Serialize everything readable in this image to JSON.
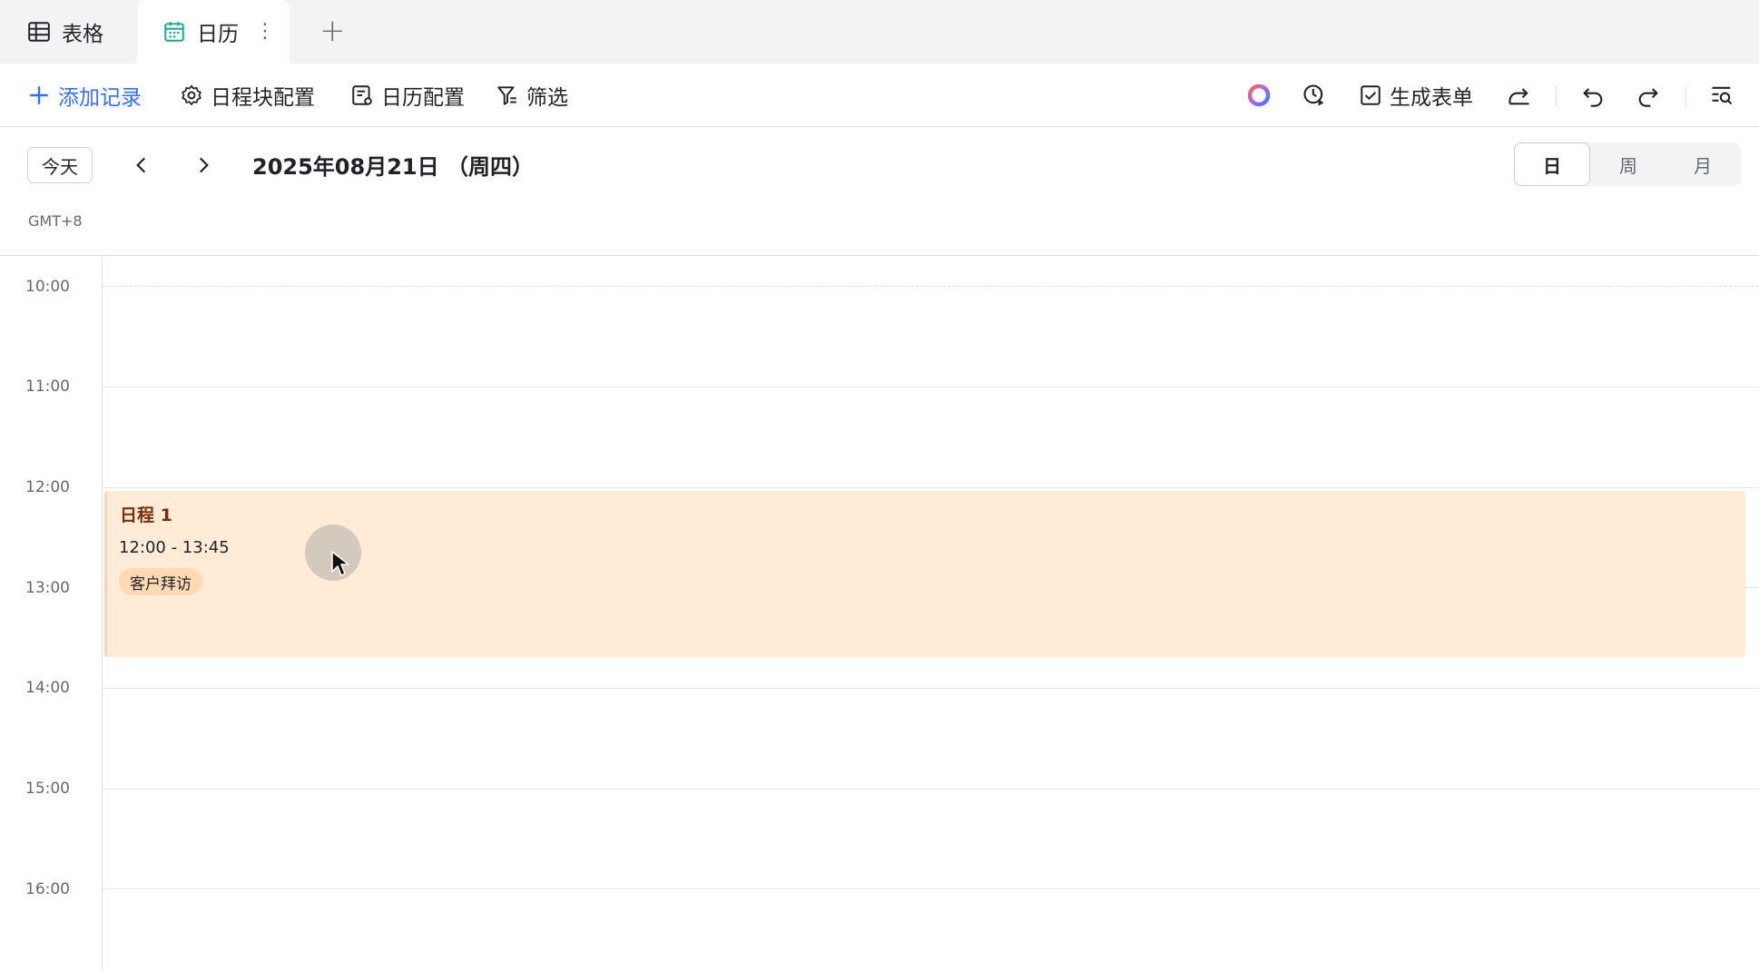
{
  "tabs": [
    {
      "label": "表格",
      "icon": "table-icon"
    },
    {
      "label": "日历",
      "icon": "calendar-icon",
      "active": true
    }
  ],
  "tab_more_glyph": "⋮",
  "tab_add_glyph": "+",
  "toolbar": {
    "add_record": "添加记录",
    "block_config": "日程块配置",
    "calendar_config": "日历配置",
    "filter": "筛选",
    "generate_form": "生成表单"
  },
  "nav": {
    "today": "今天",
    "date_title": "2025年08月21日 （周四）",
    "timezone": "GMT+8",
    "views": [
      "日",
      "周",
      "月"
    ],
    "active_view": "日"
  },
  "hours": [
    "10:00",
    "11:00",
    "12:00",
    "13:00",
    "14:00",
    "15:00",
    "16:00"
  ],
  "event": {
    "title": "日程 1",
    "time": "12:00 - 13:45",
    "tag": "客户拜访"
  },
  "colors": {
    "accent": "#3370ff",
    "event_bg": "#ffebd6",
    "event_tag_bg": "#ffd9b3",
    "event_title": "#7a2f0b"
  }
}
